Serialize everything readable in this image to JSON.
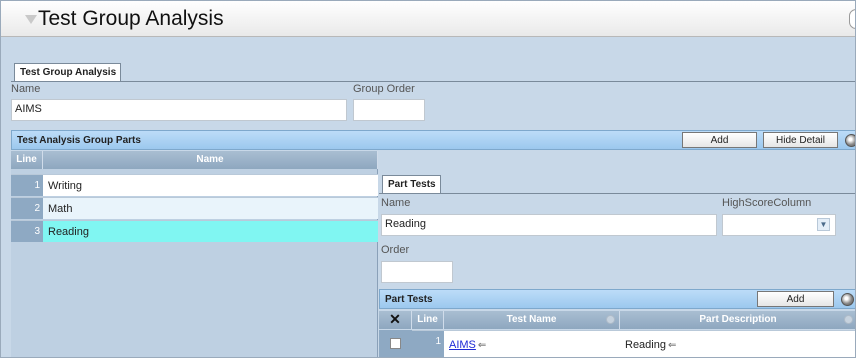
{
  "window": {
    "title": "Test Group Analysis"
  },
  "main_tab": "Test Group Analysis",
  "fields": {
    "name_label": "Name",
    "name_value": "AIMS",
    "group_order_label": "Group Order",
    "group_order_value": ""
  },
  "group_parts": {
    "title": "Test Analysis Group Parts",
    "add_label": "Add",
    "hide_detail_label": "Hide Detail",
    "columns": [
      "Line",
      "Name"
    ],
    "rows": [
      {
        "line": "1",
        "name": "Writing",
        "selected": false
      },
      {
        "line": "2",
        "name": "Math",
        "selected": false
      },
      {
        "line": "3",
        "name": "Reading",
        "selected": true
      }
    ]
  },
  "part_tests_tab": "Part Tests",
  "detail": {
    "name_label": "Name",
    "name_value": "Reading",
    "highscore_label": "HighScoreColumn",
    "highscore_value": "",
    "order_label": "Order",
    "order_value": ""
  },
  "part_tests": {
    "title": "Part Tests",
    "add_label": "Add",
    "columns": [
      "Line",
      "Test Name",
      "Part Description"
    ],
    "rows": [
      {
        "line": "1",
        "test_name": "AIMS",
        "part_description": "Reading"
      }
    ]
  },
  "icons": {
    "delete": "x-icon",
    "refresh": "refresh-icon",
    "sort": "sort-icon",
    "dropdown": "chevron-down-icon",
    "link_arrow": "arrow-left-icon"
  },
  "colors": {
    "bar": "#9cc8ee",
    "grid_header": "#8ea7bf",
    "selected_row": "#80f6f2",
    "link": "#1f2ad6"
  }
}
